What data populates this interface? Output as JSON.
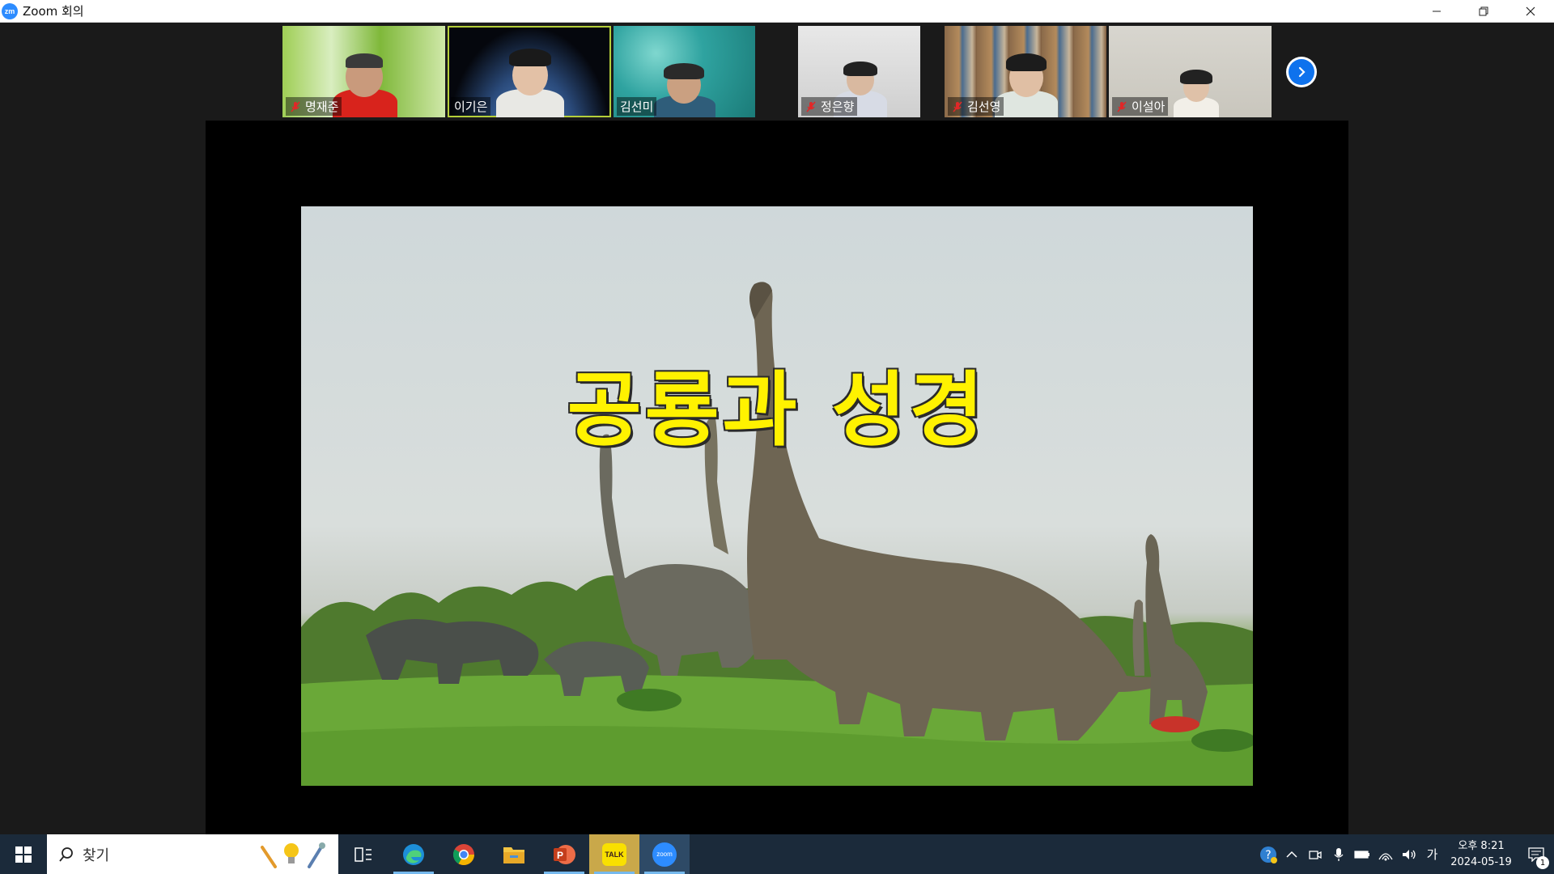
{
  "window": {
    "title": "Zoom 회의",
    "app_icon_text": "zm"
  },
  "participants": [
    {
      "name": "명재준",
      "muted": true,
      "background": "green-leaves"
    },
    {
      "name": "이기은",
      "muted": false,
      "background": "earth",
      "active_speaker": true
    },
    {
      "name": "김선미",
      "muted": false,
      "background": "turquoise-water"
    },
    {
      "name": "정은향",
      "muted": true,
      "background": "white-wall"
    },
    {
      "name": "김선영",
      "muted": true,
      "background": "bookshelf"
    },
    {
      "name": "이설아",
      "muted": true,
      "background": "beige-wall"
    }
  ],
  "slide": {
    "title": "공룡과 성경",
    "title_color": "#fff200"
  },
  "taskbar": {
    "search_placeholder": "찾기",
    "apps": [
      "task-view-icon",
      "edge-icon",
      "chrome-icon",
      "file-explorer-icon",
      "powerpoint-icon",
      "kakaotalk-icon",
      "zoom-icon"
    ],
    "kakaotalk_label": "TALK",
    "zoom_label": "zoom",
    "ime_label": "가",
    "time": "오후 8:21",
    "date": "2024-05-19",
    "notification_count": "1"
  },
  "colors": {
    "accent": "#0e72ed",
    "active_speaker_border": "#b5cf3a",
    "taskbar": "#1b2a3a"
  }
}
